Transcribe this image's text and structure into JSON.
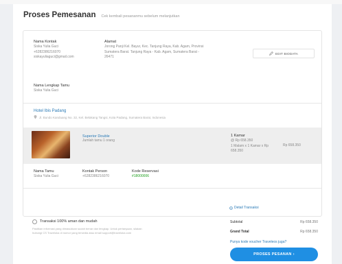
{
  "header": {
    "title": "Proses Pemesanan",
    "subtitle": "Cek kembali pesananmu sebelum melanjutkan"
  },
  "contact": {
    "contact_label": "Nama Kontak",
    "contact_name": "Siska Yulia Guci",
    "contact_phone": "+6282386216070",
    "contact_email": "siskayuliaguci@gmail.com",
    "address_label": "Alamat",
    "address_line1": "Jorong Panji Kel. Bayur, Kec. Tanjung Raya, Kab. Agam, Provinsi",
    "address_line2": "Sumatera Barat. Tanjung Raya - Kab. Agam, Sumatera Barat -",
    "address_line3": "26471",
    "edit_button": "EDIT BIODATA",
    "guest_label": "Nama Lengkap Tamu",
    "guest_name": "Siska Yulia Guci"
  },
  "hotel": {
    "name": "Hotel Ibis Padang",
    "address": "Jl. Bundo Kanduang No. 32, Kel. Belakang Tangsi, Kota Padang, Sumatera Barat, Indonesia",
    "room_type": "Superior Double",
    "room_guests": "Jumlah tamu 1 orang",
    "room_count": "1 Kamar",
    "price_line": "@ Rp 658.350",
    "calc_line": "1 Malam x 1 Kamar x Rp",
    "calc_amount": "658.350",
    "subtotal_right": "Rp 658.350"
  },
  "booking": {
    "guest_label": "Nama Tamu",
    "guest_value": "Siska Yulia Guci",
    "person_label": "Kontak Person",
    "person_value": "+6282386216070",
    "code_label": "Kode Reservasi",
    "code_value": "#18000006",
    "details_link": "Detail Transaksi"
  },
  "payment": {
    "secure_text": "Transaksi 100% aman dan mudah",
    "fine_print_1": "Pastikan informasi yang dimasukkan sudah benar dan lengkap. Untuk pertanyaan, silakan",
    "fine_print_2": "hubungi CS Traveloka di nomor yang tersedia atau email support@traveloka.com",
    "subtotal_label": "Subtotal",
    "subtotal_value": "Rp 658.350",
    "grand_total_label": "Grand Total",
    "grand_total_value": "Rp 658.350",
    "voucher_link": "Punya kode voucher Traveleos juga?",
    "pay_button": "PROSES PESANAN"
  },
  "colors": {
    "accent": "#1f8fe3",
    "link": "#2a7ab6",
    "success": "#20a020"
  }
}
